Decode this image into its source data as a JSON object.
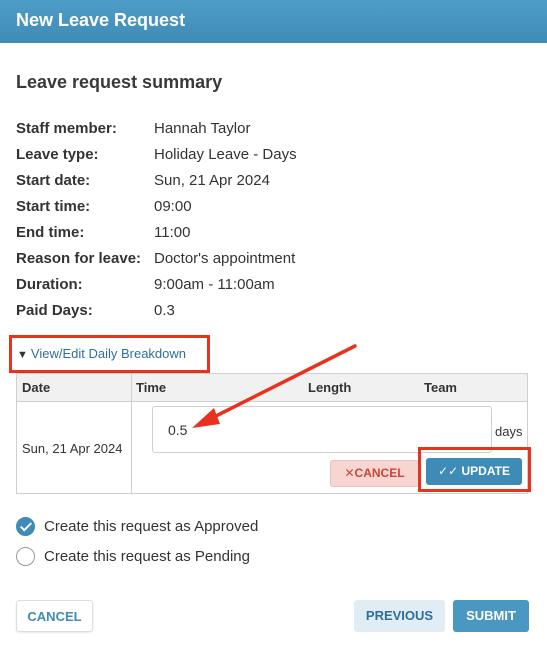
{
  "window": {
    "title": "New Leave Request"
  },
  "summary": {
    "heading": "Leave request summary",
    "rows": [
      {
        "label": "Staff member:",
        "value": "Hannah Taylor"
      },
      {
        "label": "Leave type:",
        "value": "Holiday Leave - Days"
      },
      {
        "label": "Start date:",
        "value": "Sun, 21 Apr 2024"
      },
      {
        "label": "Start time:",
        "value": "09:00"
      },
      {
        "label": "End time:",
        "value": "11:00"
      },
      {
        "label": "Reason for leave:",
        "value": "Doctor's appointment"
      },
      {
        "label": "Duration:",
        "value": "9:00am - 11:00am"
      },
      {
        "label": "Paid Days:",
        "value": "0.3"
      }
    ]
  },
  "breakdown": {
    "toggle_label": "View/Edit Daily Breakdown",
    "columns": [
      "Date",
      "Time",
      "Length",
      "Team"
    ],
    "row": {
      "date": "Sun, 21 Apr 2024",
      "length_value": "0.5",
      "unit": "days",
      "cancel_label": "CANCEL",
      "update_label": "UPDATE"
    }
  },
  "options": {
    "approved_label": "Create this request as Approved",
    "pending_label": "Create this request as Pending",
    "selected": "approved"
  },
  "footer": {
    "cancel_label": "CANCEL",
    "previous_label": "PREVIOUS",
    "submit_label": "SUBMIT"
  },
  "colors": {
    "header": "#4e9dc7",
    "primary": "#3f8bb7",
    "annotation": "#e8321e",
    "cancel_bg": "#f7d6d2"
  }
}
